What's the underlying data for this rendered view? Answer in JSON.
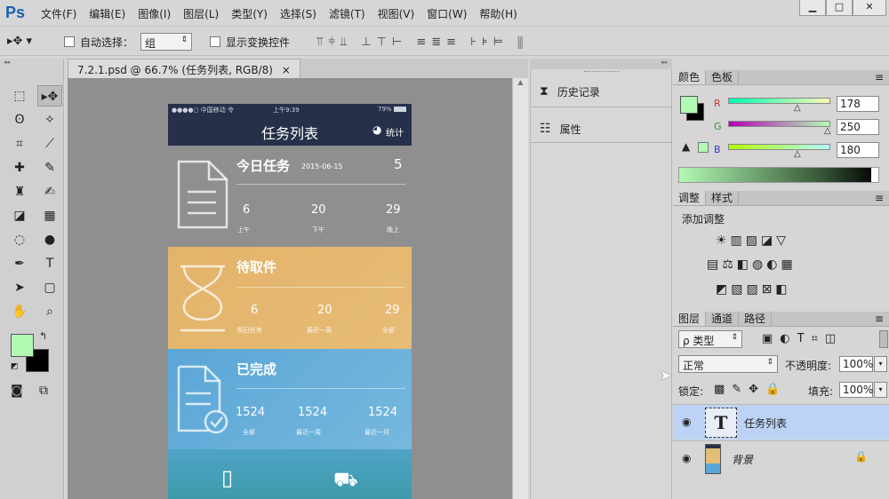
{
  "app": {
    "logo": "Ps"
  },
  "menu": [
    "文件(F)",
    "编辑(E)",
    "图像(I)",
    "图层(L)",
    "类型(Y)",
    "选择(S)",
    "滤镜(T)",
    "视图(V)",
    "窗口(W)",
    "帮助(H)"
  ],
  "window_buttons": {
    "minimize": "▁",
    "restore": "□",
    "close": "✕"
  },
  "options_bar": {
    "auto_select_label": "自动选择：",
    "auto_select_value": "组",
    "show_transform_label": "显示变换控件"
  },
  "document": {
    "tab_title": "7.2.1.psd @ 66.7% (任务列表, RGB/8)",
    "tab_close": "×"
  },
  "phone": {
    "carrier": "●●●●○ 中国移动 令",
    "time": "上午9:39",
    "battery": "79%",
    "nav_title": "任务列表",
    "stats_label": "统计",
    "sections": [
      {
        "title": "今日任务",
        "date": "2015-06-15",
        "count": "5",
        "stats": [
          {
            "value": "6",
            "label": "上午"
          },
          {
            "value": "20",
            "label": "下午"
          },
          {
            "value": "29",
            "label": "晚上"
          }
        ]
      },
      {
        "title": "待取件",
        "date": "",
        "count": "",
        "stats": [
          {
            "value": "6",
            "label": "明日任务"
          },
          {
            "value": "20",
            "label": "最近一周"
          },
          {
            "value": "29",
            "label": "全部"
          }
        ]
      },
      {
        "title": "已完成",
        "date": "",
        "count": "",
        "stats": [
          {
            "value": "1524",
            "label": "全部"
          },
          {
            "value": "1524",
            "label": "最近一周"
          },
          {
            "value": "1524",
            "label": "最近一月"
          }
        ]
      }
    ]
  },
  "middle_panel": {
    "history_label": "历史记录",
    "properties_label": "属性"
  },
  "color_panel": {
    "tabs": [
      "颜色",
      "色板"
    ],
    "channels": [
      {
        "name": "R",
        "value": "178",
        "color": "#ff6a6a"
      },
      {
        "name": "G",
        "value": "250",
        "color": "#4ad44a"
      },
      {
        "name": "B",
        "value": "180",
        "color": "#4a6aff"
      }
    ],
    "foreground": "#b2fab4",
    "background": "#000000"
  },
  "adjust_panel": {
    "tabs": [
      "调整",
      "样式"
    ],
    "title": "添加调整"
  },
  "layers_panel": {
    "tabs": [
      "图层",
      "通道",
      "路径"
    ],
    "filter_label": "ρ 类型",
    "blend_mode": "正常",
    "opacity_label": "不透明度:",
    "opacity_value": "100%",
    "lock_label": "锁定:",
    "fill_label": "填充:",
    "fill_value": "100%",
    "layers": [
      {
        "name": "任务列表",
        "type_glyph": "T",
        "selected": true
      },
      {
        "name": "背景",
        "type_glyph": "",
        "selected": false,
        "locked": true
      }
    ]
  },
  "colors": {
    "accent_selected": "#bcd3f5",
    "nav_dark": "#26304a"
  }
}
